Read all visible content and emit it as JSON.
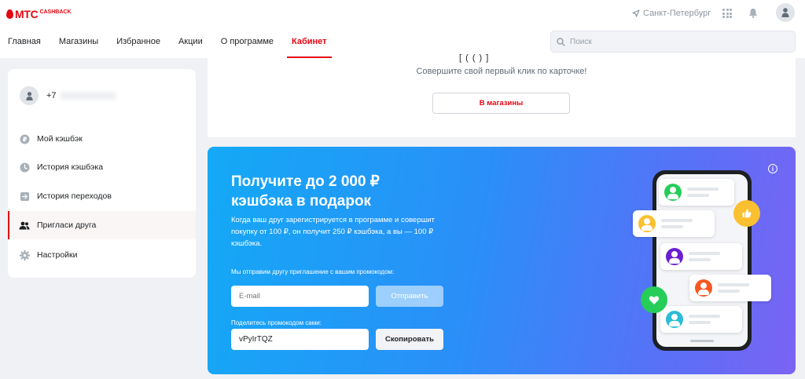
{
  "header": {
    "logo_mts": "МТС",
    "logo_cashback": "CASHBACK",
    "city": "Санкт-Петербург",
    "nav": [
      "Главная",
      "Магазины",
      "Избранное",
      "Акции",
      "О программе",
      "Кабинет"
    ],
    "active_nav": "Кабинет",
    "search_placeholder": "Поиск"
  },
  "sidebar": {
    "phone_prefix": "+7",
    "items": [
      {
        "label": "Мой кэшбэк",
        "icon": "ruble-coin-icon"
      },
      {
        "label": "История кэшбэка",
        "icon": "clock-icon"
      },
      {
        "label": "История переходов",
        "icon": "arrow-exit-icon"
      },
      {
        "label": "Пригласи друга",
        "icon": "people-icon",
        "active": true
      },
      {
        "label": "Настройки",
        "icon": "gear-icon"
      }
    ]
  },
  "top_card": {
    "cut_text": "[ ( (  )  ]",
    "hint": "Совершите свой первый клик по карточке!",
    "button": "В магазины"
  },
  "promo": {
    "title_line1": "Получите до 2 000 ₽",
    "title_line2": "кэшбэка в подарок",
    "description": "Когда ваш друг зарегистрируется в программе и совершит покупку от 100 ₽, он получит 250 ₽ кэшбэка, а вы — 100 ₽ кэшбэка.",
    "invite_label": "Мы отправим другу приглашение с вашим промокодом:",
    "email_placeholder": "E-mail",
    "send_button": "Отправить",
    "share_label": "Поделитесь промокодом сами:",
    "promo_code": "vPyIrTQZ",
    "copy_button": "Скопировать"
  },
  "colors": {
    "brand_red": "#e30611",
    "promo_blue": "#14a9f6",
    "promo_violet": "#7b63f4"
  }
}
